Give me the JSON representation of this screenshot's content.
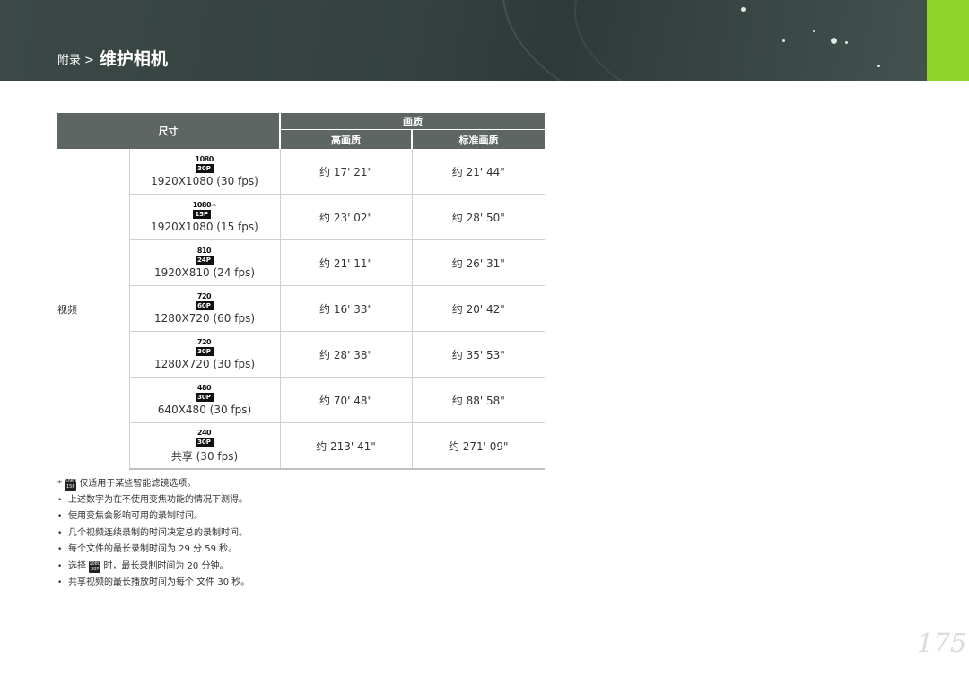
{
  "header": {
    "section": "附录",
    "separator": ">",
    "title": "维护相机",
    "accent_color": "#8fd22a",
    "background_color": "#36423f"
  },
  "table": {
    "col_size": "尺寸",
    "col_quality": "画质",
    "col_high": "高画质",
    "col_standard": "标准画质",
    "category": "视频",
    "rows": [
      {
        "icon_top": "1080",
        "icon_bottom": "30P",
        "label": "1920X1080 (30 fps)",
        "asterisk": "",
        "high": "约 17' 21\"",
        "standard": "约 21' 44\""
      },
      {
        "icon_top": "1080",
        "icon_bottom": "15P",
        "label": "1920X1080 (15 fps)",
        "asterisk": "*",
        "high": "约 23' 02\"",
        "standard": "约 28' 50\""
      },
      {
        "icon_top": "810",
        "icon_bottom": "24P",
        "label": "1920X810 (24 fps)",
        "asterisk": "",
        "high": "约 21' 11\"",
        "standard": "约 26' 31\""
      },
      {
        "icon_top": "720",
        "icon_bottom": "60P",
        "label": "1280X720 (60 fps)",
        "asterisk": "",
        "high": "约 16' 33\"",
        "standard": "约 20' 42\""
      },
      {
        "icon_top": "720",
        "icon_bottom": "30P",
        "label": "1280X720 (30 fps)",
        "asterisk": "",
        "high": "约 28' 38\"",
        "standard": "约 35' 53\""
      },
      {
        "icon_top": "480",
        "icon_bottom": "30P",
        "label": "640X480 (30 fps)",
        "asterisk": "",
        "high": "约 70' 48\"",
        "standard": "约 88' 58\""
      },
      {
        "icon_top": "240",
        "icon_bottom": "30P",
        "label": "共享 (30 fps)",
        "asterisk": "",
        "high": "约 213' 41\"",
        "standard": "约 271' 09\""
      }
    ]
  },
  "notes": {
    "footnote_mark": "*",
    "footnote_icon_top": "1080",
    "footnote_icon_bottom": "15P",
    "footnote_text": "仅适用于某些智能滤镜选项。",
    "bullet": "•",
    "items": [
      "上述数字为在不使用变焦功能的情况下测得。",
      "使用变焦会影响可用的录制时间。",
      "几个视频连续录制的时间决定总的录制时间。",
      "每个文件的最长录制时间为 29 分 59 秒。"
    ],
    "select_prefix": "选择",
    "select_icon_top": "1080",
    "select_icon_bottom": "30P",
    "select_suffix": "时，最长录制时间为 20 分钟。",
    "last_item": "共享视频的最长播放时间为每个 文件 30 秒。"
  },
  "page_number": "175"
}
